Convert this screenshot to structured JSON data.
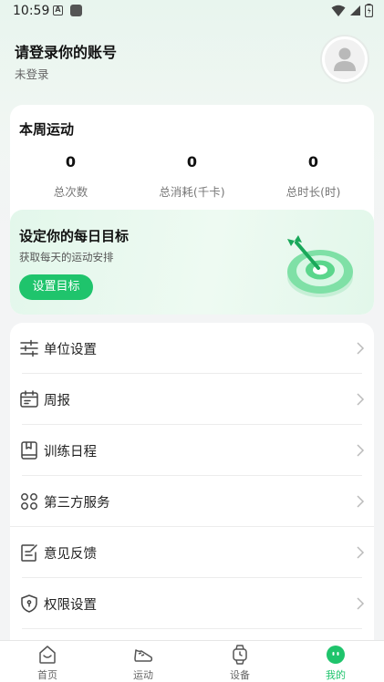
{
  "status_bar": {
    "time": "10:59",
    "notif_a": "A"
  },
  "profile": {
    "title": "请登录你的账号",
    "subtitle": "未登录"
  },
  "weekly": {
    "title": "本周运动",
    "stats": [
      {
        "value": "0",
        "label": "总次数"
      },
      {
        "value": "0",
        "label": "总消耗(千卡)"
      },
      {
        "value": "0",
        "label": "总时长(时)"
      }
    ]
  },
  "goal": {
    "title": "设定你的每日目标",
    "subtitle": "获取每天的运动安排",
    "button": "设置目标"
  },
  "menu": [
    {
      "label": "单位设置",
      "icon": "sliders-icon"
    },
    {
      "label": "周报",
      "icon": "calendar-icon"
    },
    {
      "label": "训练日程",
      "icon": "book-icon"
    },
    {
      "label": "第三方服务",
      "icon": "grid-icon"
    },
    {
      "label": "意见反馈",
      "icon": "feedback-icon"
    },
    {
      "label": "权限设置",
      "icon": "shield-icon"
    }
  ],
  "tabs": [
    {
      "label": "首页",
      "icon": "home-icon"
    },
    {
      "label": "运动",
      "icon": "shoe-icon"
    },
    {
      "label": "设备",
      "icon": "watch-icon"
    },
    {
      "label": "我的",
      "icon": "profile-icon"
    }
  ],
  "colors": {
    "accent": "#1fc46c",
    "background": "#f3f4f5"
  }
}
